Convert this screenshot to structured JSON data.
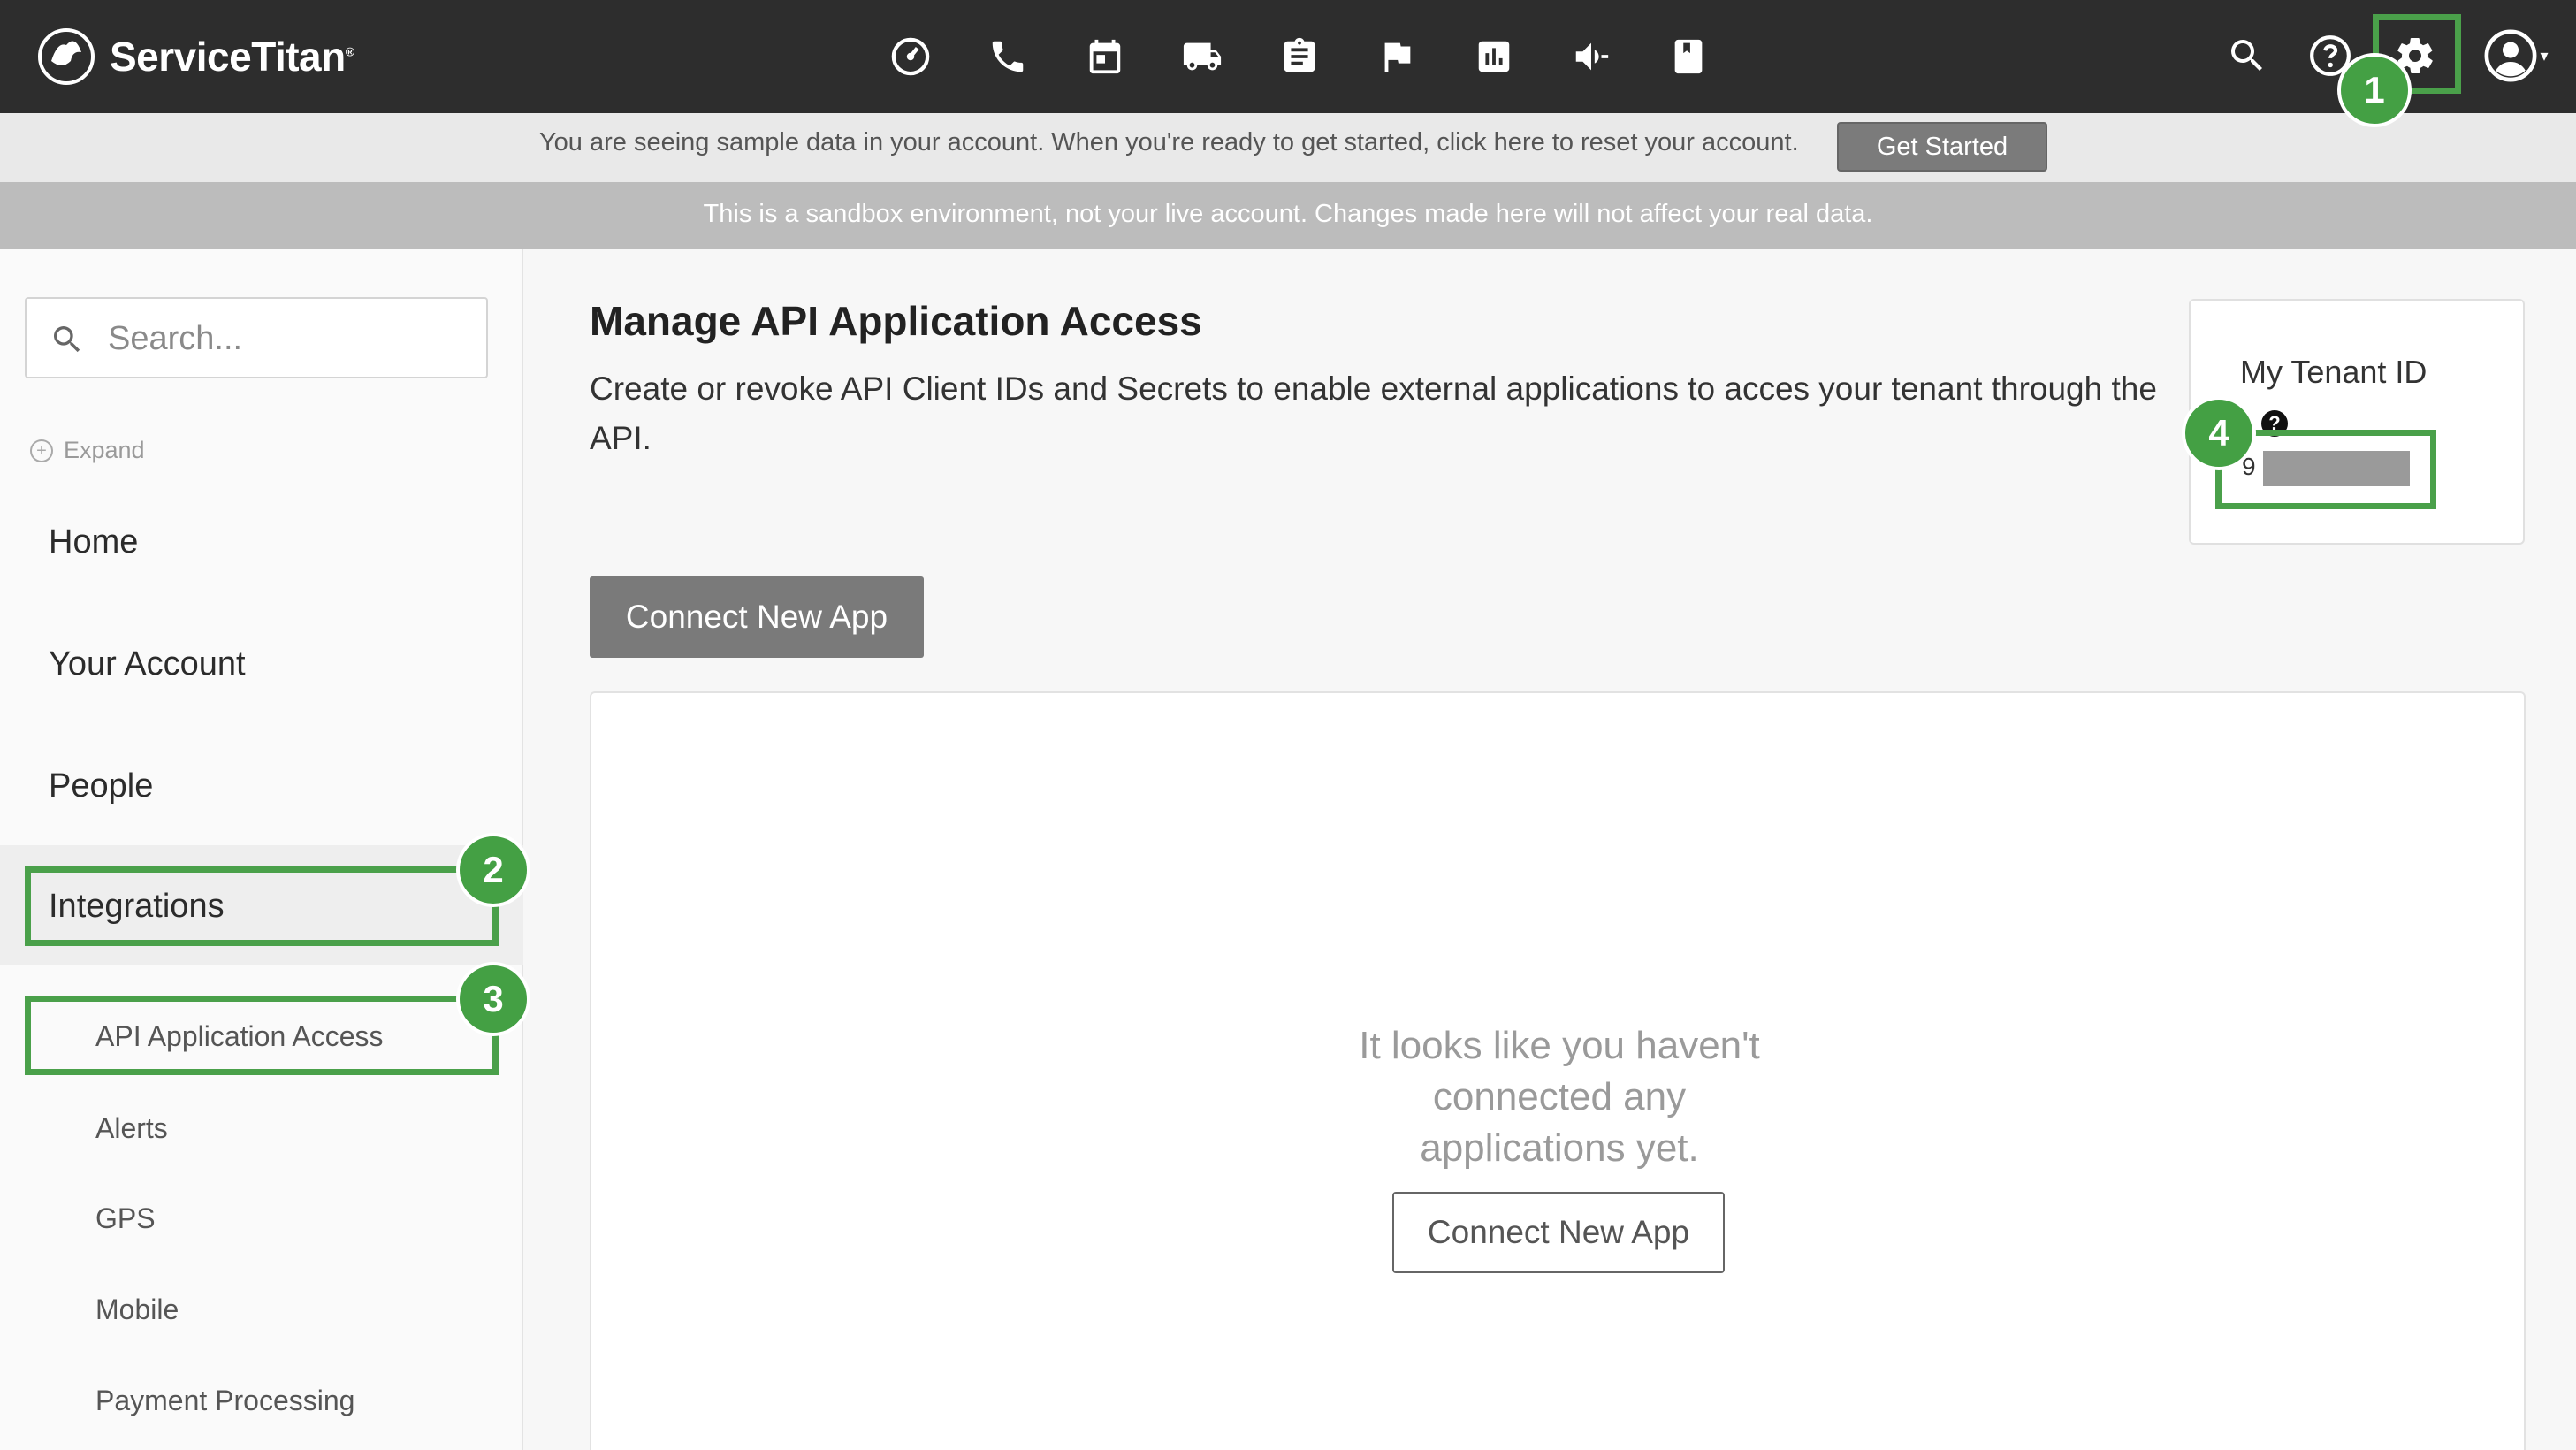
{
  "brand": {
    "name": "ServiceTitan",
    "mark": "®"
  },
  "nav_icons": [
    "dashboard-icon",
    "phone-icon",
    "calendar-icon",
    "truck-icon",
    "clipboard-icon",
    "flag-icon",
    "reports-icon",
    "megaphone-icon",
    "book-icon"
  ],
  "banners": {
    "sample": "You are seeing sample data in your account. When you're ready to get started, click here to reset your account.",
    "get_started": "Get Started",
    "sandbox": "This is a sandbox environment, not your live account. Changes made here will not affect your real data."
  },
  "sidebar": {
    "search_placeholder": "Search...",
    "expand": "Expand",
    "items": [
      "Home",
      "Your Account",
      "People",
      "Integrations"
    ],
    "subitems": [
      "API Application Access",
      "Alerts",
      "GPS",
      "Mobile",
      "Payment Processing"
    ]
  },
  "main": {
    "title": "Manage API Application Access",
    "description": "Create or revoke API Client IDs and Secrets to enable external applications to acces your tenant through the API.",
    "connect_button": "Connect New App",
    "empty_message": "It looks like you haven't connected any applications yet.",
    "empty_button": "Connect New App"
  },
  "tenant": {
    "title": "My Tenant ID",
    "help": "?",
    "value_prefix": "9"
  },
  "annotations": [
    "1",
    "2",
    "3",
    "4"
  ],
  "colors": {
    "nav_bg": "#2d2d2d",
    "highlight": "#4aa04a"
  }
}
